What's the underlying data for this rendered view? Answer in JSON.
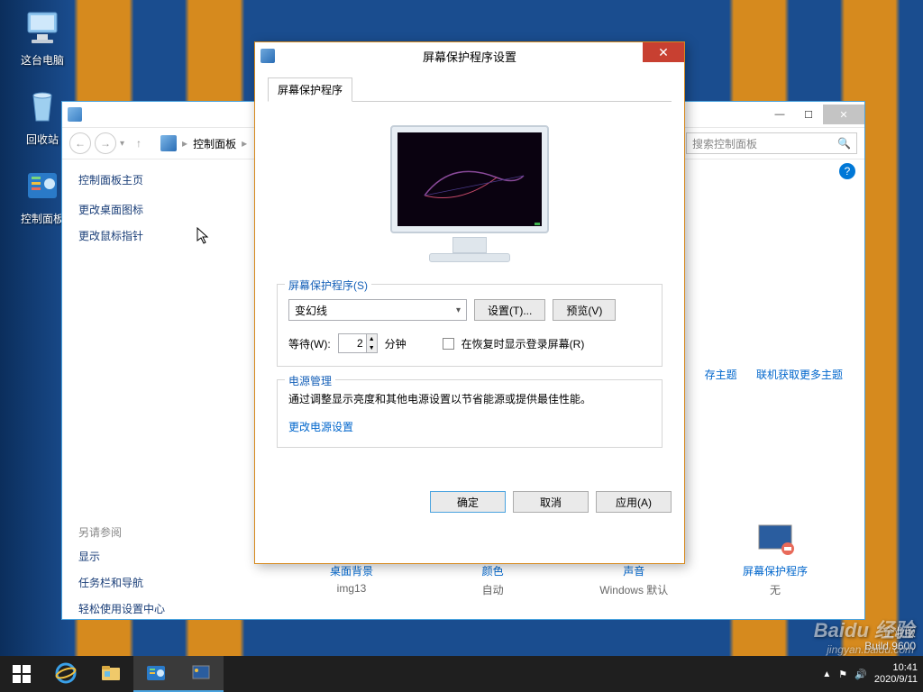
{
  "desktop": {
    "icons": [
      {
        "label": "这台电脑"
      },
      {
        "label": "回收站"
      },
      {
        "label": "控制面板"
      }
    ]
  },
  "cp_window": {
    "breadcrumb": "控制面板",
    "search_placeholder": "搜索控制面板",
    "sidebar": {
      "home": "控制面板主页",
      "links": [
        "更改桌面图标",
        "更改鼠标指针"
      ],
      "see_also_label": "另请参阅",
      "see_also": [
        "显示",
        "任务栏和导航",
        "轻松使用设置中心"
      ]
    },
    "theme_links": {
      "save": "存主题",
      "online": "联机获取更多主题"
    },
    "pers": [
      {
        "title": "桌面背景",
        "value": "img13"
      },
      {
        "title": "颜色",
        "value": "自动"
      },
      {
        "title": "声音",
        "value": "Windows 默认"
      },
      {
        "title": "屏幕保护程序",
        "value": "无"
      }
    ]
  },
  "ss_dialog": {
    "title": "屏幕保护程序设置",
    "tab": "屏幕保护程序",
    "group_label": "屏幕保护程序(S)",
    "combo_value": "变幻线",
    "settings_btn": "设置(T)...",
    "preview_btn": "预览(V)",
    "wait_label": "等待(W):",
    "wait_value": "2",
    "wait_unit": "分钟",
    "resume_checkbox": "在恢复时显示登录屏幕(R)",
    "power_group": "电源管理",
    "power_text": "通过调整显示亮度和其他电源设置以节省能源或提供最佳性能。",
    "power_link": "更改电源设置",
    "ok": "确定",
    "cancel": "取消",
    "apply": "应用(A)"
  },
  "watermark": {
    "edition": "企业版",
    "build": "Build 9600"
  },
  "baidu": {
    "brand": "Baidu 经验",
    "url": "jingyan.baidu.com"
  },
  "taskbar": {
    "time": "10:41",
    "date": "2020/9/11"
  }
}
